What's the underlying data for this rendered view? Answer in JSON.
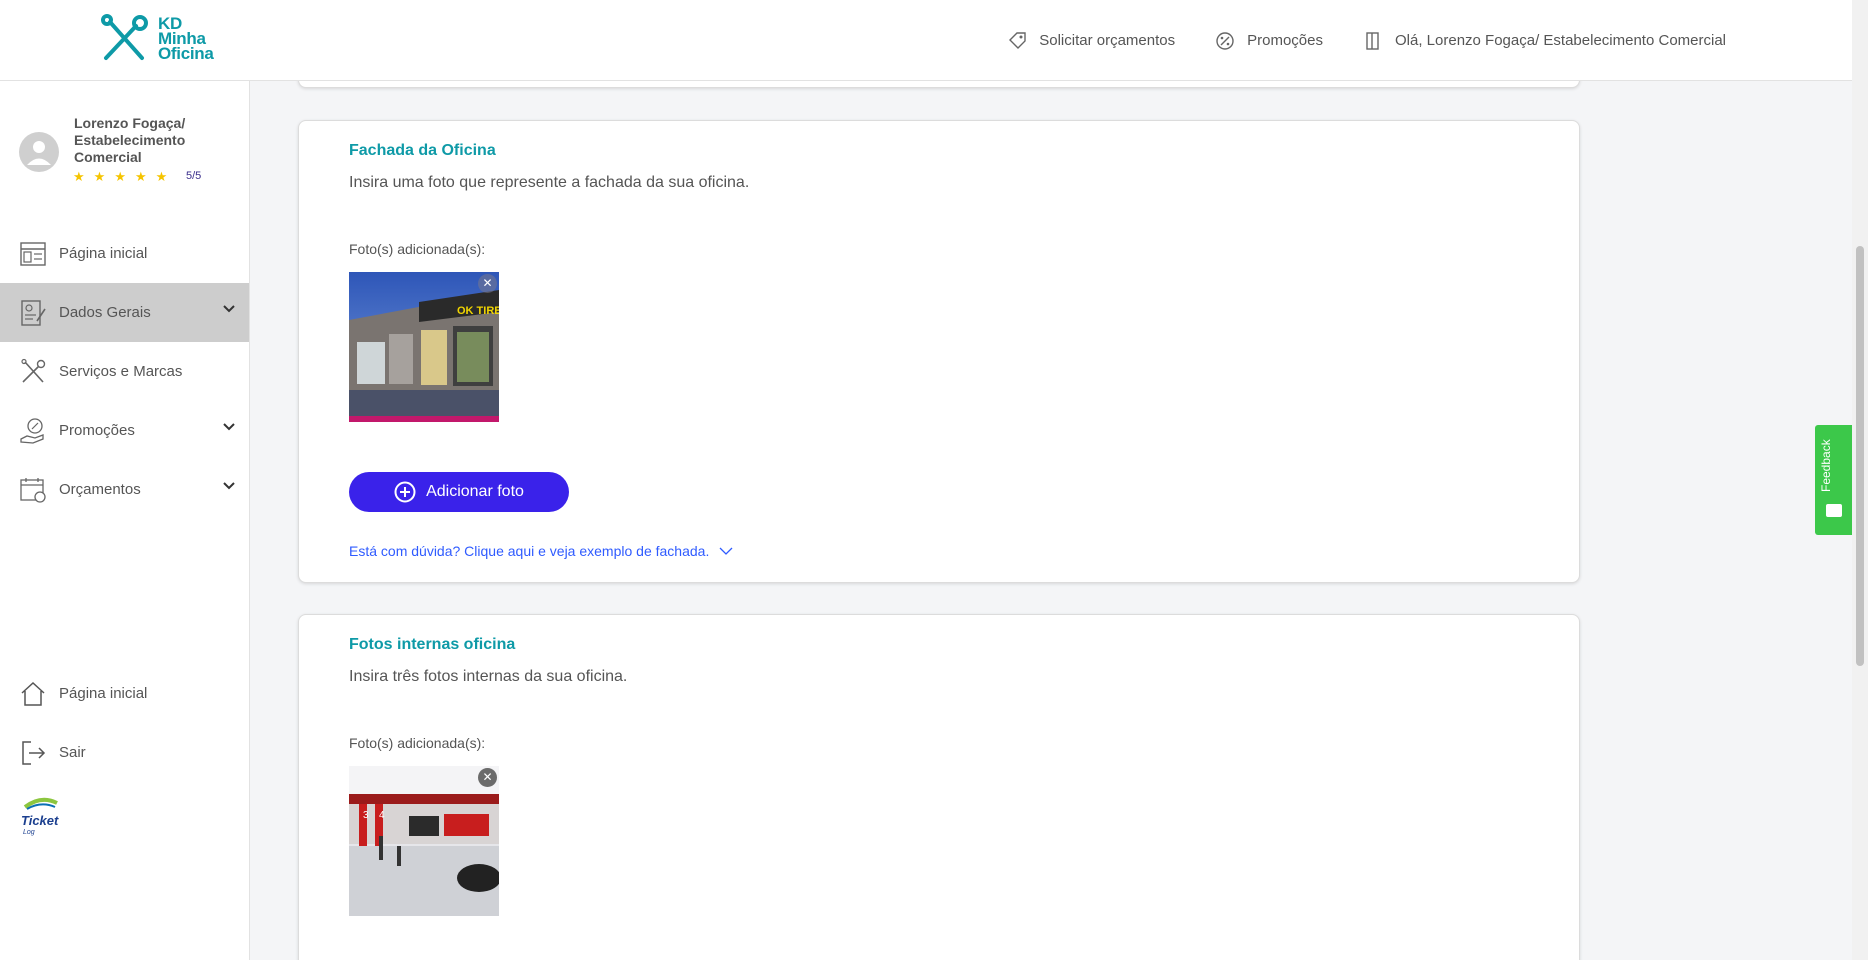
{
  "app": {
    "logo_lines": [
      "KD",
      "Minha",
      "Oficina"
    ],
    "accent_color": "#0e9aa7",
    "button_color": "#3a22ea"
  },
  "header": {
    "nav": [
      {
        "label": "Solicitar orçamentos",
        "icon": "tag-icon"
      },
      {
        "label": "Promoções",
        "icon": "percent-icon"
      },
      {
        "label": "Olá, Lorenzo Fogaça/ Estabelecimento Comercial",
        "icon": "door-icon"
      }
    ]
  },
  "sidebar": {
    "profile": {
      "name": "Lorenzo Fogaça/ Estabelecimento Comercial",
      "stars": 5,
      "rating": "5/5"
    },
    "items": [
      {
        "label": "Página inicial",
        "icon": "dashboard-icon"
      },
      {
        "label": "Dados Gerais",
        "icon": "document-edit-icon",
        "active": true,
        "expandable": true
      },
      {
        "label": "Serviços e Marcas",
        "icon": "tools-icon"
      },
      {
        "label": "Promoções",
        "icon": "hand-percent-icon",
        "expandable": true
      },
      {
        "label": "Orçamentos",
        "icon": "calendar-icon",
        "expandable": true
      }
    ],
    "bottom_items": [
      {
        "label": "Página inicial",
        "icon": "home-icon"
      },
      {
        "label": "Sair",
        "icon": "logout-icon"
      }
    ],
    "partner_logo_text": "Ticket Log"
  },
  "sections": [
    {
      "title": "Fachada da Oficina",
      "description": "Insira uma foto que represente a fachada da sua oficina.",
      "photos_label": "Foto(s) adicionada(s):",
      "photo_sign_text": "OK TIRE",
      "add_button": "Adicionar foto",
      "help_link": "Está com dúvida? Clique aqui e veja exemplo de fachada."
    },
    {
      "title": "Fotos internas oficina",
      "description": "Insira três fotos internas da sua oficina.",
      "photos_label": "Foto(s) adicionada(s):"
    }
  ],
  "feedback": {
    "label": "Feedback",
    "color": "#3cc84a"
  }
}
